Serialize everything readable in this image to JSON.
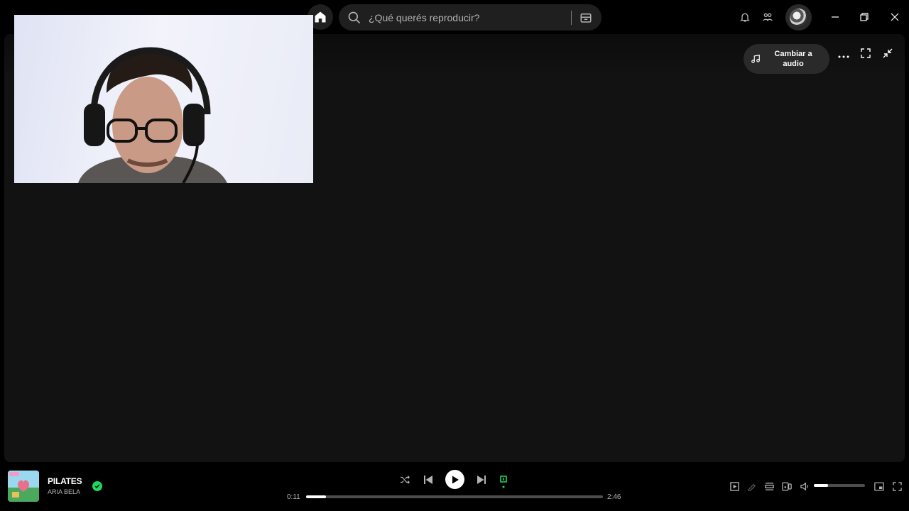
{
  "search": {
    "placeholder": "¿Qué querés reproducir?"
  },
  "video_panel": {
    "switch_to_audio_label": "Cambiar a audio"
  },
  "now_playing": {
    "title": "PILATES",
    "artist": "ARIA BELA",
    "elapsed": "0:11",
    "duration": "2:46",
    "progress_fraction": 0.066,
    "volume_fraction": 0.28
  },
  "colors": {
    "accent": "#1ed760",
    "background": "#000000",
    "panel": "#121212",
    "muted_text": "#b3b3b3"
  },
  "icons": [
    "back-icon",
    "forward-icon",
    "home-icon",
    "search-icon",
    "browse-icon",
    "bell-icon",
    "friends-icon",
    "minimize-icon",
    "restore-icon",
    "close-icon",
    "music-note-icon",
    "more-icon",
    "fullscreen-icon",
    "collapse-icon",
    "shuffle-icon",
    "previous-icon",
    "play-icon",
    "next-icon",
    "repeat-icon",
    "now-playing-view-icon",
    "lyrics-icon",
    "queue-icon",
    "connect-device-icon",
    "volume-icon",
    "miniplayer-icon",
    "fullscreen-icon"
  ]
}
